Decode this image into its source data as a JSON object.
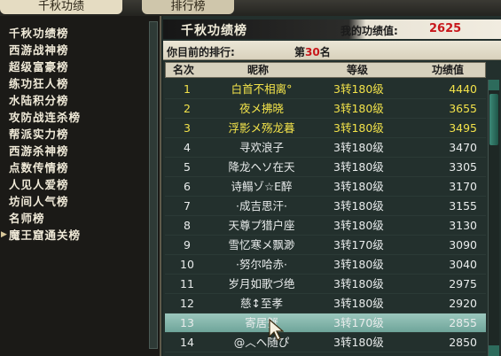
{
  "tabs": [
    "千秋功绩",
    "排行榜"
  ],
  "sidebar": {
    "items": [
      {
        "label": "千秋功绩榜"
      },
      {
        "label": "西游战神榜"
      },
      {
        "label": "超级富豪榜"
      },
      {
        "label": "练功狂人榜"
      },
      {
        "label": "水陆积分榜"
      },
      {
        "label": "攻防战连杀榜"
      },
      {
        "label": "帮派实力榜"
      },
      {
        "label": "西游杀神榜"
      },
      {
        "label": "点数传情榜"
      },
      {
        "label": "人见人爱榜"
      },
      {
        "label": "坊间人气榜"
      },
      {
        "label": "名师榜"
      },
      {
        "label": "魔王窟通关榜"
      }
    ]
  },
  "panel": {
    "title": "千秋功绩榜",
    "my_score_label": "我的功绩值:",
    "my_score_value": "2625",
    "rank_label": "你目前的排行:",
    "rank_prefix": "第",
    "rank_value": "30",
    "rank_suffix": "名"
  },
  "table": {
    "headers": [
      "名次",
      "昵称",
      "等级",
      "功绩值"
    ],
    "rows": [
      {
        "rank": "1",
        "name": "白首不相离°",
        "level": "3转180级",
        "score": "4440"
      },
      {
        "rank": "2",
        "name": "夜メ拂晓",
        "level": "3转180级",
        "score": "3655"
      },
      {
        "rank": "3",
        "name": "浮影メ殇龙暮",
        "level": "3转180级",
        "score": "3495"
      },
      {
        "rank": "4",
        "name": "寻欢浪子",
        "level": "3转180级",
        "score": "3470"
      },
      {
        "rank": "5",
        "name": "降龙ヘソ在天",
        "level": "3转180级",
        "score": "3305"
      },
      {
        "rank": "6",
        "name": "诗鳎ゾ☆E醉",
        "level": "3转180级",
        "score": "3170"
      },
      {
        "rank": "7",
        "name": "·成吉思汗·",
        "level": "3转180级",
        "score": "3155"
      },
      {
        "rank": "8",
        "name": "天尊プ猎户座",
        "level": "3转180级",
        "score": "3130"
      },
      {
        "rank": "9",
        "name": "雪忆寒メ飘渺",
        "level": "3转170级",
        "score": "3090"
      },
      {
        "rank": "10",
        "name": "·努尔哈赤·",
        "level": "3转180级",
        "score": "3040"
      },
      {
        "rank": "11",
        "name": "岁月如歌づ绝",
        "level": "3转180级",
        "score": "2975"
      },
      {
        "rank": "12",
        "name": "慈↕至孝",
        "level": "3转180级",
        "score": "2920"
      },
      {
        "rank": "13",
        "name": "寄居蟹",
        "level": "3转170级",
        "score": "2855"
      },
      {
        "rank": "14",
        "name": "@︿ヘ随ぴ",
        "level": "3转180级",
        "score": "2850"
      }
    ],
    "selected_rank": "13"
  },
  "colors": {
    "top_three": "#f2e24a",
    "normal": "#e9ecec",
    "rank_highlight": "#c8171b",
    "selected_row": "#84b6ab"
  }
}
